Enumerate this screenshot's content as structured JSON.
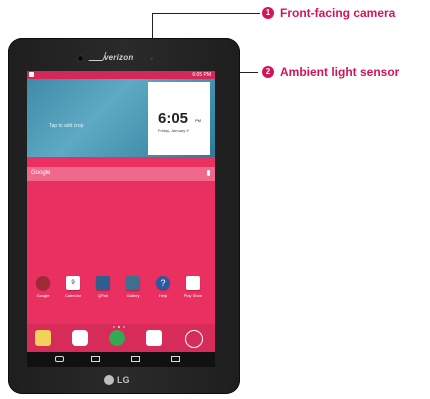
{
  "callouts": [
    {
      "number": "1",
      "label": "Front-facing camera"
    },
    {
      "number": "2",
      "label": "Ambient light sensor"
    }
  ],
  "device": {
    "carrier": "verizon",
    "brand": "LG"
  },
  "screen": {
    "status_time": "6:05 PM",
    "photo_hint": "Tap to add crop",
    "clock_time": "6:05",
    "clock_ampm": "PM",
    "clock_date": "Friday, January 9",
    "search_placeholder": "Google",
    "apps": [
      {
        "label": "Google",
        "color": "#9e2a35"
      },
      {
        "label": "Calendar",
        "color": "#ffffff"
      },
      {
        "label": "QPair",
        "color": "#2e5f8f"
      },
      {
        "label": "Gallery",
        "color": "#3d6f8e"
      },
      {
        "label": "Help",
        "color": "#2c5aa0"
      },
      {
        "label": "Play Store",
        "color": "#ffffff"
      }
    ],
    "calendar_day": "9",
    "dock_colors": [
      "#f2d25a",
      "#ffffff",
      "#34a853",
      "#ffffff",
      "#ffffff"
    ]
  }
}
